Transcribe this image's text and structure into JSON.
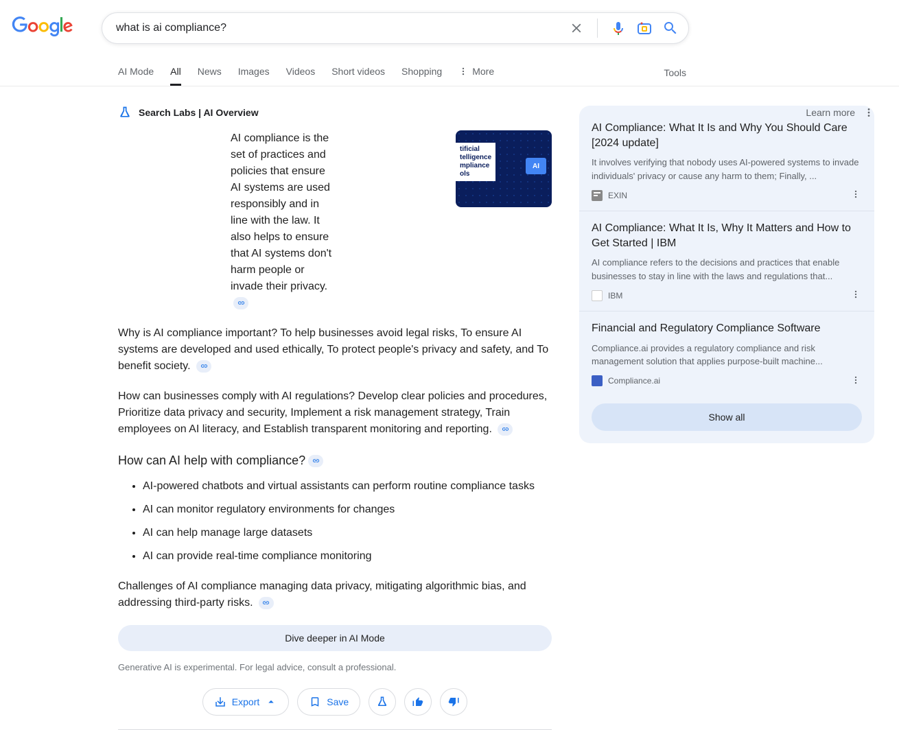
{
  "search": {
    "query": "what is ai compliance?"
  },
  "tabs": {
    "items": [
      "AI Mode",
      "All",
      "News",
      "Images",
      "Videos",
      "Short videos",
      "Shopping"
    ],
    "more": "More",
    "tools": "Tools",
    "activeIndex": 1
  },
  "labs": {
    "header": "Search Labs | AI Overview",
    "learn_more": "Learn more"
  },
  "overview": {
    "para1": "AI compliance is the set of practices and policies that ensure AI systems are used responsibly and in line with the law. It also helps to ensure that AI systems don't harm people or invade their privacy.",
    "para2": "Why is AI compliance important? To help businesses avoid legal risks, To ensure AI systems are developed and used ethically, To protect people's privacy and safety, and To benefit society.",
    "para3": "How can businesses comply with AI regulations? Develop clear policies and procedures, Prioritize data privacy and security, Implement a risk management strategy, Train employees on AI literacy, and Establish transparent monitoring and reporting.",
    "heading": "How can AI help with compliance?",
    "bullets": [
      "AI-powered chatbots and virtual assistants can perform routine compliance tasks",
      "AI can monitor regulatory environments for changes",
      "AI can help manage large datasets",
      "AI can provide real-time compliance monitoring"
    ],
    "para4": "Challenges of AI compliance managing data privacy, mitigating algorithmic bias, and addressing third-party risks.",
    "dive": "Dive deeper in AI Mode",
    "disclaimer": "Generative AI is experimental. For legal advice, consult a professional.",
    "export": "Export",
    "save": "Save"
  },
  "thumb": {
    "line1": "tificial",
    "line2": "telligence",
    "line3": "mpliance",
    "line4": "ols",
    "chip": "AI"
  },
  "sources": {
    "cards": [
      {
        "title": "AI Compliance: What It Is and Why You Should Care [2024 update]",
        "snippet": "It involves verifying that nobody uses AI-powered systems to invade individuals' privacy or cause any harm to them; Finally, ...",
        "source": "EXIN"
      },
      {
        "title": "AI Compliance: What It Is, Why It Matters and How to Get Started | IBM",
        "snippet": "AI compliance refers to the decisions and practices that enable businesses to stay in line with the laws and regulations that...",
        "source": "IBM"
      },
      {
        "title": "Financial and Regulatory Compliance Software",
        "snippet": "Compliance.ai provides a regulatory compliance and risk management solution that applies purpose-built machine...",
        "source": "Compliance.ai"
      }
    ],
    "show_all": "Show all"
  }
}
